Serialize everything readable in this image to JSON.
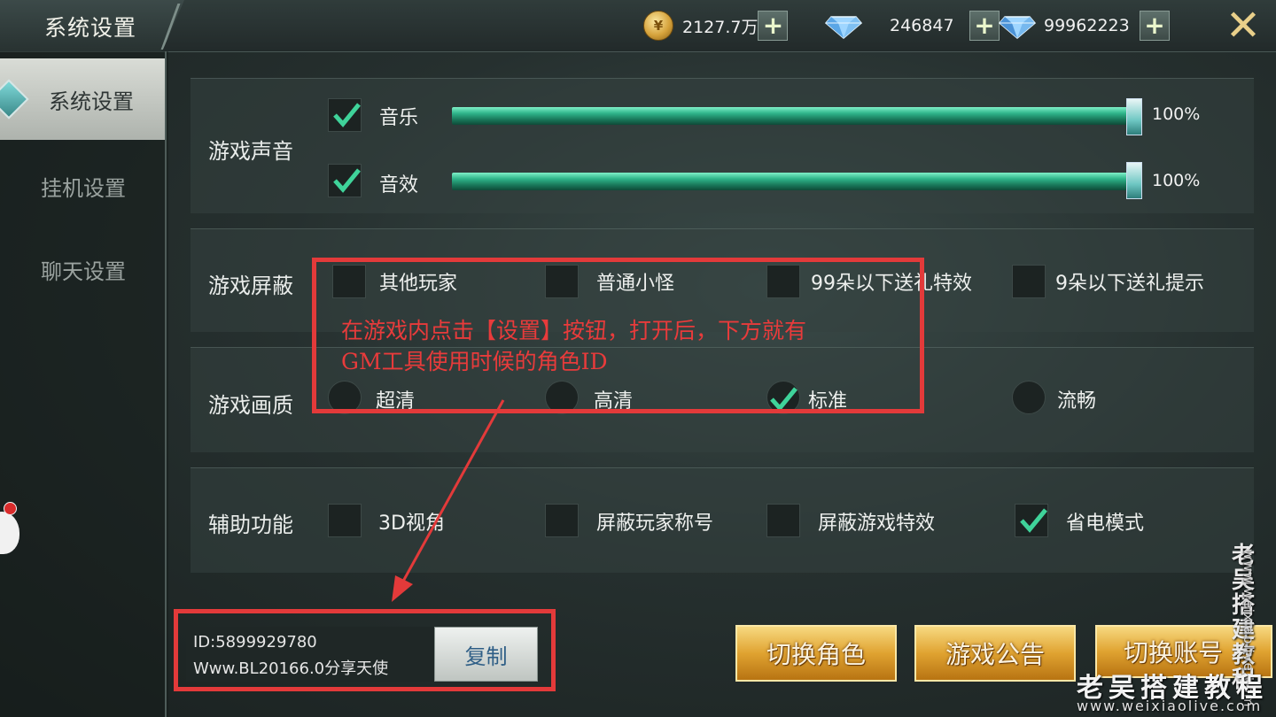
{
  "header": {
    "title": "系统设置",
    "gold_value": "2127.7万",
    "diamond_value": "246847",
    "bound_diamond_value": "99962223",
    "gold_icon": "coin-icon",
    "diamond_icon": "diamond-icon",
    "plus_icon": "plus-icon",
    "close_icon": "close-icon"
  },
  "sidebar": {
    "items": [
      {
        "label": "系统设置",
        "active": true
      },
      {
        "label": "挂机设置",
        "active": false
      },
      {
        "label": "聊天设置",
        "active": false
      }
    ]
  },
  "sound": {
    "label": "游戏声音",
    "music_label": "音乐",
    "music_checked": true,
    "music_value": "100%",
    "sfx_label": "音效",
    "sfx_checked": true,
    "sfx_value": "100%"
  },
  "block": {
    "label": "游戏屏蔽",
    "options": [
      {
        "label": "其他玩家",
        "checked": false
      },
      {
        "label": "普通小怪",
        "checked": false
      },
      {
        "label": "99朵以下送礼特效",
        "checked": false
      },
      {
        "label": "9朵以下送礼提示",
        "checked": false
      }
    ]
  },
  "quality": {
    "label": "游戏画质",
    "options": [
      {
        "label": "超清",
        "selected": false
      },
      {
        "label": "高清",
        "selected": false
      },
      {
        "label": "标准",
        "selected": true
      },
      {
        "label": "流畅",
        "selected": false
      }
    ]
  },
  "assist": {
    "label": "辅助功能",
    "options": [
      {
        "label": "3D视角",
        "checked": false
      },
      {
        "label": "屏蔽玩家称号",
        "checked": false
      },
      {
        "label": "屏蔽游戏特效",
        "checked": false
      },
      {
        "label": "省电模式",
        "checked": true
      }
    ]
  },
  "annotation": {
    "line1": "在游戏内点击【设置】按钮，打开后，下方就有",
    "line2": "GM工具使用时候的角色ID"
  },
  "account": {
    "id_text": "ID:5899929780",
    "server_text": "Www.BL20166.0",
    "server_suffix": "分享天使",
    "copy_label": "复制"
  },
  "buttons": {
    "switch_role": "切换角色",
    "announcement": "游戏公告",
    "switch_account": "切换账号"
  },
  "watermark": {
    "brand": "老吴搭建教程",
    "url": "www.weixiaolive.com"
  },
  "colors": {
    "accent_gold": "#e0a331",
    "annotation_red": "#e33a3a",
    "check_green": "#3fd39a"
  }
}
